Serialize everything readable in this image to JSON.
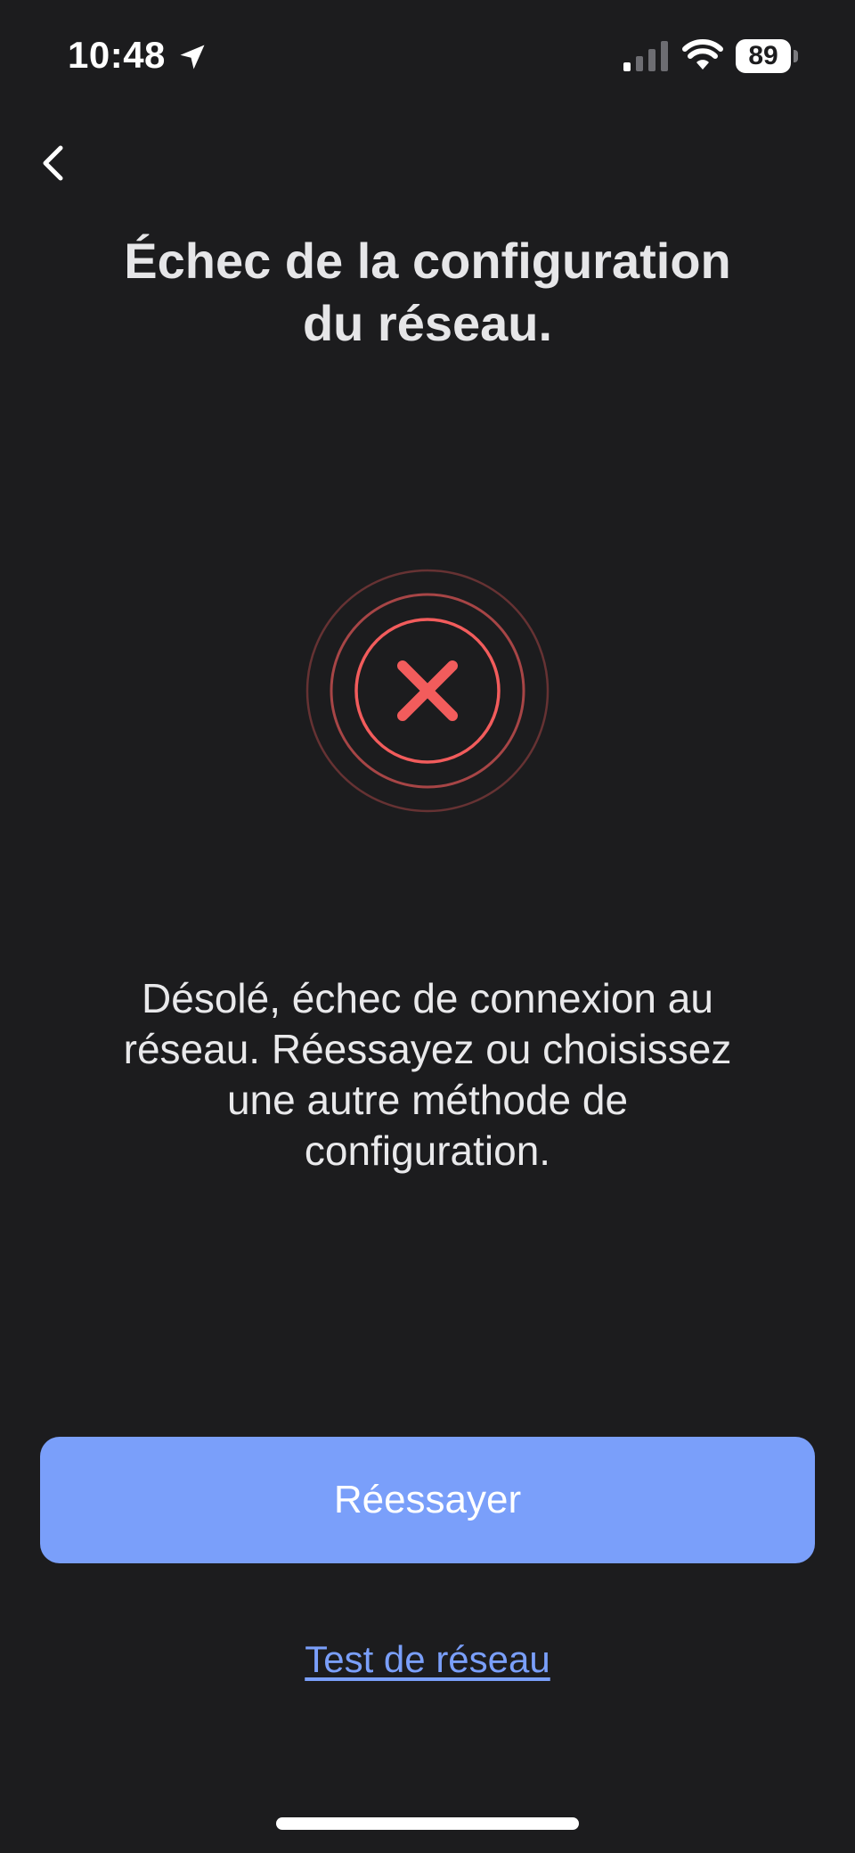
{
  "status_bar": {
    "time": "10:48",
    "battery_level": "89",
    "icons": [
      "location-arrow-icon",
      "cellular-signal-icon",
      "wifi-icon",
      "battery-icon"
    ]
  },
  "navigation": {
    "back_icon": "chevron-left-icon"
  },
  "title": {
    "line1": "Échec de la configuration",
    "line2": "du réseau."
  },
  "error_icon": "error-x-icon",
  "message": {
    "line1": "Désolé, échec de connexion au",
    "line2": "réseau. Réessayez ou choisissez",
    "line3": "une autre méthode de",
    "line4": "configuration."
  },
  "actions": {
    "retry_label": "Réessayer",
    "network_test_label": "Test de réseau"
  },
  "colors": {
    "background": "#1c1c1e",
    "primary_button": "#7a9ffa",
    "link": "#7a9ffa",
    "error": "#f25c5c"
  }
}
